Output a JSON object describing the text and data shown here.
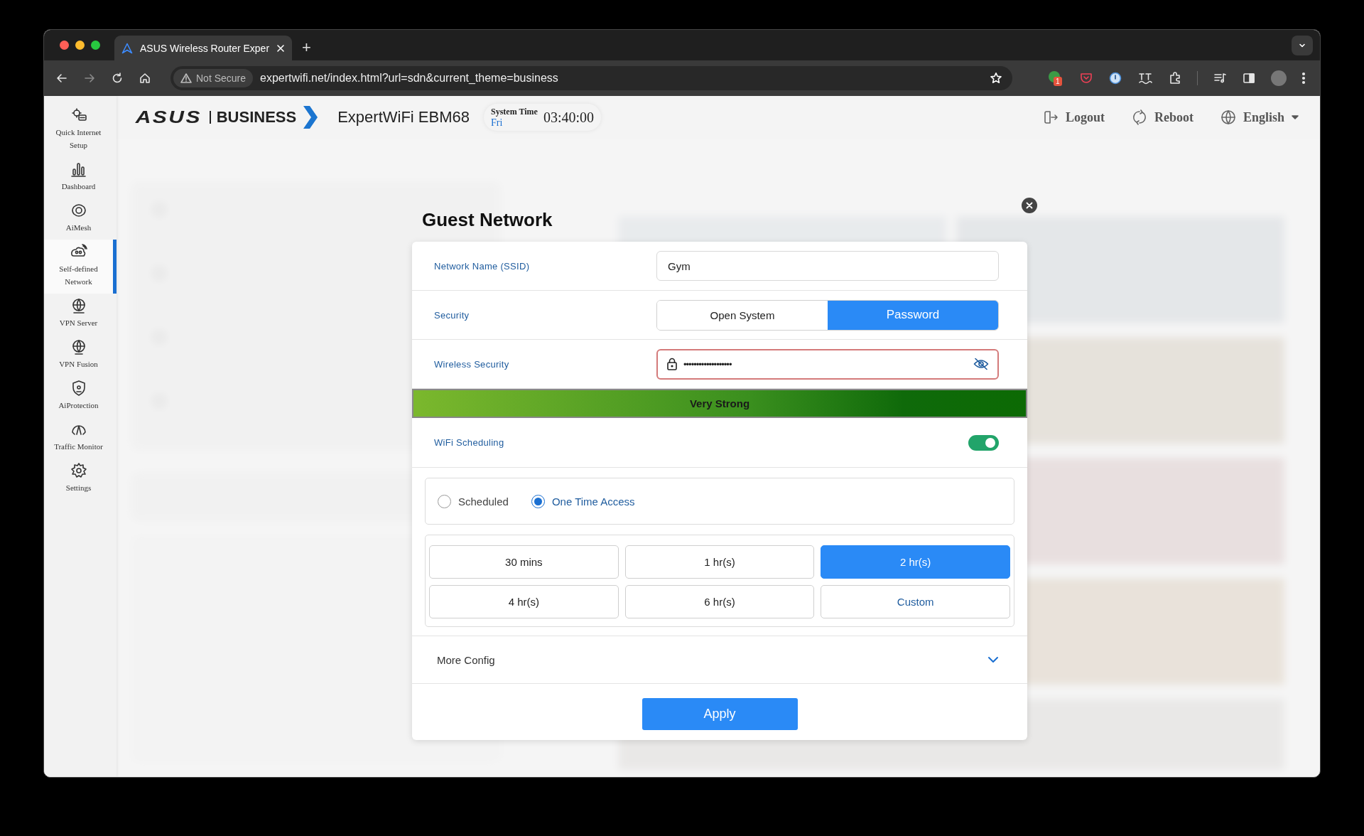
{
  "browser": {
    "tabs": [
      {
        "title": "ASUS Wireless Router Exper",
        "selected": true
      }
    ],
    "new_tab": "+",
    "security_chip": "Not Secure",
    "url": "expertwifi.net/index.html?url=sdn&current_theme=business",
    "extension_badge": "1"
  },
  "sidebar": {
    "items": [
      {
        "label": "Quick Internet Setup",
        "selected": false
      },
      {
        "label": "Dashboard",
        "selected": false
      },
      {
        "label": "AiMesh",
        "selected": false
      },
      {
        "label": "Self-defined Network",
        "selected": true
      },
      {
        "label": "VPN Server",
        "selected": false
      },
      {
        "label": "VPN Fusion",
        "selected": false
      },
      {
        "label": "AiProtection",
        "selected": false
      },
      {
        "label": "Traffic Monitor",
        "selected": false
      },
      {
        "label": "Settings",
        "selected": false
      }
    ]
  },
  "header": {
    "logo": "ASUS",
    "brand": "BUSINESS",
    "model": "ExpertWiFi EBM68",
    "system_time": {
      "label": "System Time",
      "day": "Fri",
      "time": "03:40:00"
    },
    "actions": [
      {
        "kind": "logout",
        "label": "Logout"
      },
      {
        "kind": "reboot",
        "label": "Reboot"
      },
      {
        "kind": "language",
        "label": "English"
      }
    ]
  },
  "modal": {
    "title": "Guest Network",
    "ssid": {
      "label": "Network Name (SSID)",
      "value": "Gym"
    },
    "security": {
      "label": "Security",
      "options": [
        {
          "label": "Open System",
          "selected": false
        },
        {
          "label": "Password",
          "selected": true
        }
      ]
    },
    "wireless_security": {
      "label": "Wireless Security",
      "value": "•••••••••••••••••••",
      "highlighted": true
    },
    "strength": {
      "label": "Very Strong",
      "level": 1
    },
    "wifi_scheduling": {
      "label": "WiFi Scheduling",
      "on": true
    },
    "schedule_modes": [
      {
        "label": "Scheduled",
        "selected": false
      },
      {
        "label": "One Time Access",
        "selected": true
      }
    ],
    "durations": [
      {
        "label": "30 mins",
        "selected": false
      },
      {
        "label": "1 hr(s)",
        "selected": false
      },
      {
        "label": "2 hr(s)",
        "selected": true
      },
      {
        "label": "4 hr(s)",
        "selected": false
      },
      {
        "label": "6 hr(s)",
        "selected": false
      },
      {
        "label": "Custom",
        "selected": false,
        "kind": "custom"
      }
    ],
    "more_config": {
      "label": "More Config",
      "expanded": false
    },
    "apply": "Apply"
  }
}
